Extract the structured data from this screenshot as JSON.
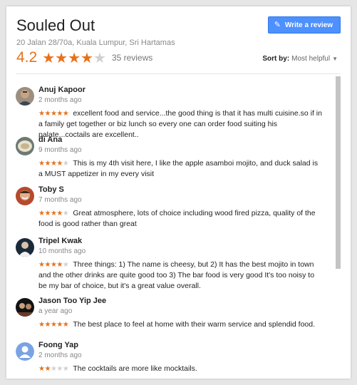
{
  "place": {
    "name": "Souled Out",
    "address": "20 Jalan 28/70a, Kuala Lumpur, Sri Hartamas",
    "rating": "4.2",
    "rating_stars": 4,
    "review_count": "35 reviews"
  },
  "actions": {
    "write_review": "Write a review"
  },
  "sort": {
    "label": "Sort by:",
    "value": "Most helpful"
  },
  "colors": {
    "accent": "#e7711b",
    "button": "#4d90fe"
  },
  "reviews": [
    {
      "name": "Anuj Kapoor",
      "time": "2 months ago",
      "stars": 5,
      "text": "excellent food and service...the good thing is that it has multi cuisine.so if in a family get together or biz lunch so every one can order food suiting his palate...coctails are excellent..",
      "avatar": "photo-man"
    },
    {
      "name": "di Ana",
      "time": "9 months ago",
      "stars": 4,
      "text": "This is my 4th visit here, I like the apple asamboi mojito, and duck salad is a MUST appetizer in my every visit",
      "avatar": "photo-plate"
    },
    {
      "name": "Toby S",
      "time": "7 months ago",
      "stars": 4,
      "text": "Great atmosphere, lots of choice including wood fired pizza, quality of the food is good rather than great",
      "avatar": "photo-smiling-man"
    },
    {
      "name": "Tripel Kwak",
      "time": "10 months ago",
      "stars": 4,
      "text": "Three things: 1) The name is cheesy, but 2) It has the best mojito in town and the other drinks are quite good too 3) The bar food is very good It's too noisy to be my bar of choice, but it's a great value overall.",
      "avatar": "photo-dark"
    },
    {
      "name": "Jason Too Yip Jee",
      "time": "a year ago",
      "stars": 5,
      "text": "The best place to feel at home with their warm service and splendid food.",
      "avatar": "photo-night"
    },
    {
      "name": "Foong Yap",
      "time": "2 months ago",
      "stars": 2,
      "text": "The cocktails are more like mocktails.",
      "avatar": "default-person-icon"
    }
  ]
}
